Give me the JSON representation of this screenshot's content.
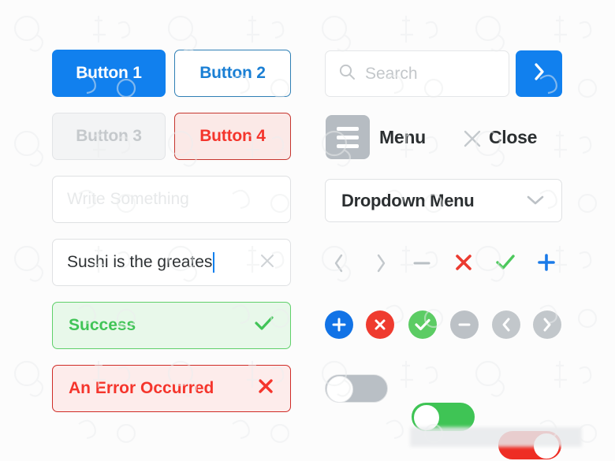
{
  "meta": {
    "kit_title": "UI Kit Components",
    "background_color": "#fcfcfc"
  },
  "colors": {
    "blue": "#1180ee",
    "blue_text": "#1a7fd4",
    "red": "#f4352c",
    "red_border": "#c6352e",
    "green": "#41c457",
    "green_border": "#5fd06a",
    "grey": "#b6bcc2",
    "grey_light": "#dfe1e3",
    "disabled_text": "#c5c9cc",
    "dark_text": "#2b2f31"
  },
  "buttons": [
    {
      "label": "Button 1",
      "style": "primary",
      "icon": ""
    },
    {
      "label": "Button 2",
      "style": "outline",
      "icon": ""
    },
    {
      "label": "Button 3",
      "style": "disabled",
      "icon": ""
    },
    {
      "label": "Button 4",
      "style": "danger",
      "icon": ""
    }
  ],
  "inputs": {
    "empty": {
      "placeholder": "Write Something",
      "value": ""
    },
    "filled": {
      "placeholder": "",
      "value": "Sushi is the greates",
      "clear_icon": "close-x-icon",
      "has_caret": true
    }
  },
  "alerts": [
    {
      "label": "Success",
      "icon": "check-icon",
      "style": "success"
    },
    {
      "label": "An Error Occurred",
      "icon": "close-x-icon",
      "style": "error"
    }
  ],
  "search": {
    "placeholder": "Search",
    "value": "",
    "search_icon": "search-icon",
    "submit_icon": "chevron-right-icon",
    "submit_label": ""
  },
  "menu_row": {
    "menu_icon": "hamburger-icon",
    "menu_label": "Menu",
    "close_icon": "close-x-icon",
    "close_label": "Close"
  },
  "dropdown": {
    "selected": "Dropdown Menu",
    "chevron_icon": "chevron-down-icon",
    "options": [
      "Dropdown Menu"
    ]
  },
  "flat_icons": [
    {
      "name": "chevron-left-icon",
      "color": "#c3c8cc"
    },
    {
      "name": "chevron-right-icon",
      "color": "#c3c8cc"
    },
    {
      "name": "minus-icon",
      "color": "#b9bfc4"
    },
    {
      "name": "close-x-icon",
      "color": "#eb3b30"
    },
    {
      "name": "check-icon",
      "color": "#4cc85c"
    },
    {
      "name": "plus-icon",
      "color": "#1a7ae8"
    }
  ],
  "circle_icons": [
    {
      "name": "plus-circle-icon",
      "bg": "#1273e6",
      "glyph": "plus"
    },
    {
      "name": "close-circle-icon",
      "bg": "#ef3b2f",
      "glyph": "close"
    },
    {
      "name": "check-circle-icon",
      "bg": "#5ccc64",
      "glyph": "check"
    },
    {
      "name": "minus-circle-icon",
      "bg": "#bcc1c6",
      "glyph": "minus"
    },
    {
      "name": "chevron-left-circle-icon",
      "bg": "#c2c7cb",
      "glyph": "chev-left"
    },
    {
      "name": "chevron-right-circle-icon",
      "bg": "#c2c7cb",
      "glyph": "chev-right"
    }
  ],
  "toggles": [
    {
      "name": "toggle-grey-off",
      "state": "off",
      "track_color": "#b9bfc5",
      "border_color": "#e2e4e6"
    },
    {
      "name": "toggle-green-off",
      "state": "off",
      "track_color": "#3fc455",
      "border_color": "#3fc455"
    },
    {
      "name": "toggle-red-on",
      "state": "on",
      "track_color": "#ee2d24",
      "border_color": "#ee2d24"
    }
  ]
}
